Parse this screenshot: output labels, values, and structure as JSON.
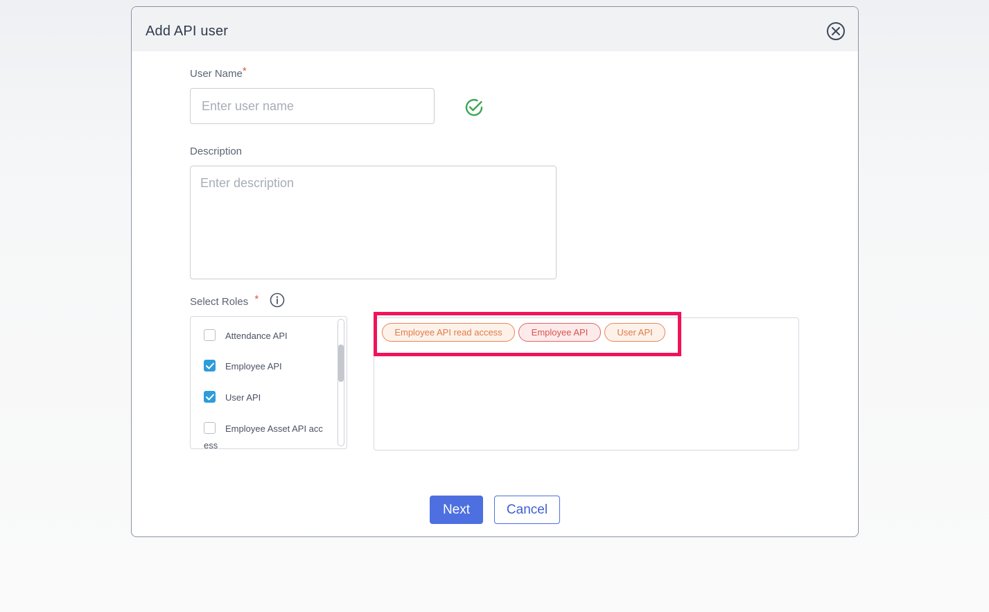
{
  "modal": {
    "title": "Add API user"
  },
  "username": {
    "label": "User Name",
    "required_mark": "*",
    "placeholder": "Enter user name",
    "value": ""
  },
  "description": {
    "label": "Description",
    "placeholder": "Enter description",
    "value": ""
  },
  "roles": {
    "label": "Select Roles",
    "required_mark": "*",
    "options": [
      {
        "label": "Attendance API",
        "checked": false
      },
      {
        "label": "Employee API",
        "checked": true
      },
      {
        "label": "User API",
        "checked": true
      },
      {
        "label": "Employee Asset API acc",
        "label_wrap": "ess",
        "checked": false
      }
    ],
    "selected_chips": [
      {
        "label": "Employee API read access"
      },
      {
        "label": "Employee API"
      },
      {
        "label": "User API"
      }
    ]
  },
  "buttons": {
    "next": "Next",
    "cancel": "Cancel"
  },
  "colors": {
    "primary": "#4d6fe0",
    "checkbox_checked": "#2d9cdb",
    "valid_check": "#3aa655",
    "required": "#e2553b",
    "highlight": "#f0135a",
    "chip_orange": "#e07a46",
    "chip_red": "#d9534f"
  },
  "icons": {
    "close": "close-circle-icon",
    "valid": "check-circle-icon",
    "info": "info-icon",
    "checkbox_check": "checkmark-icon"
  }
}
